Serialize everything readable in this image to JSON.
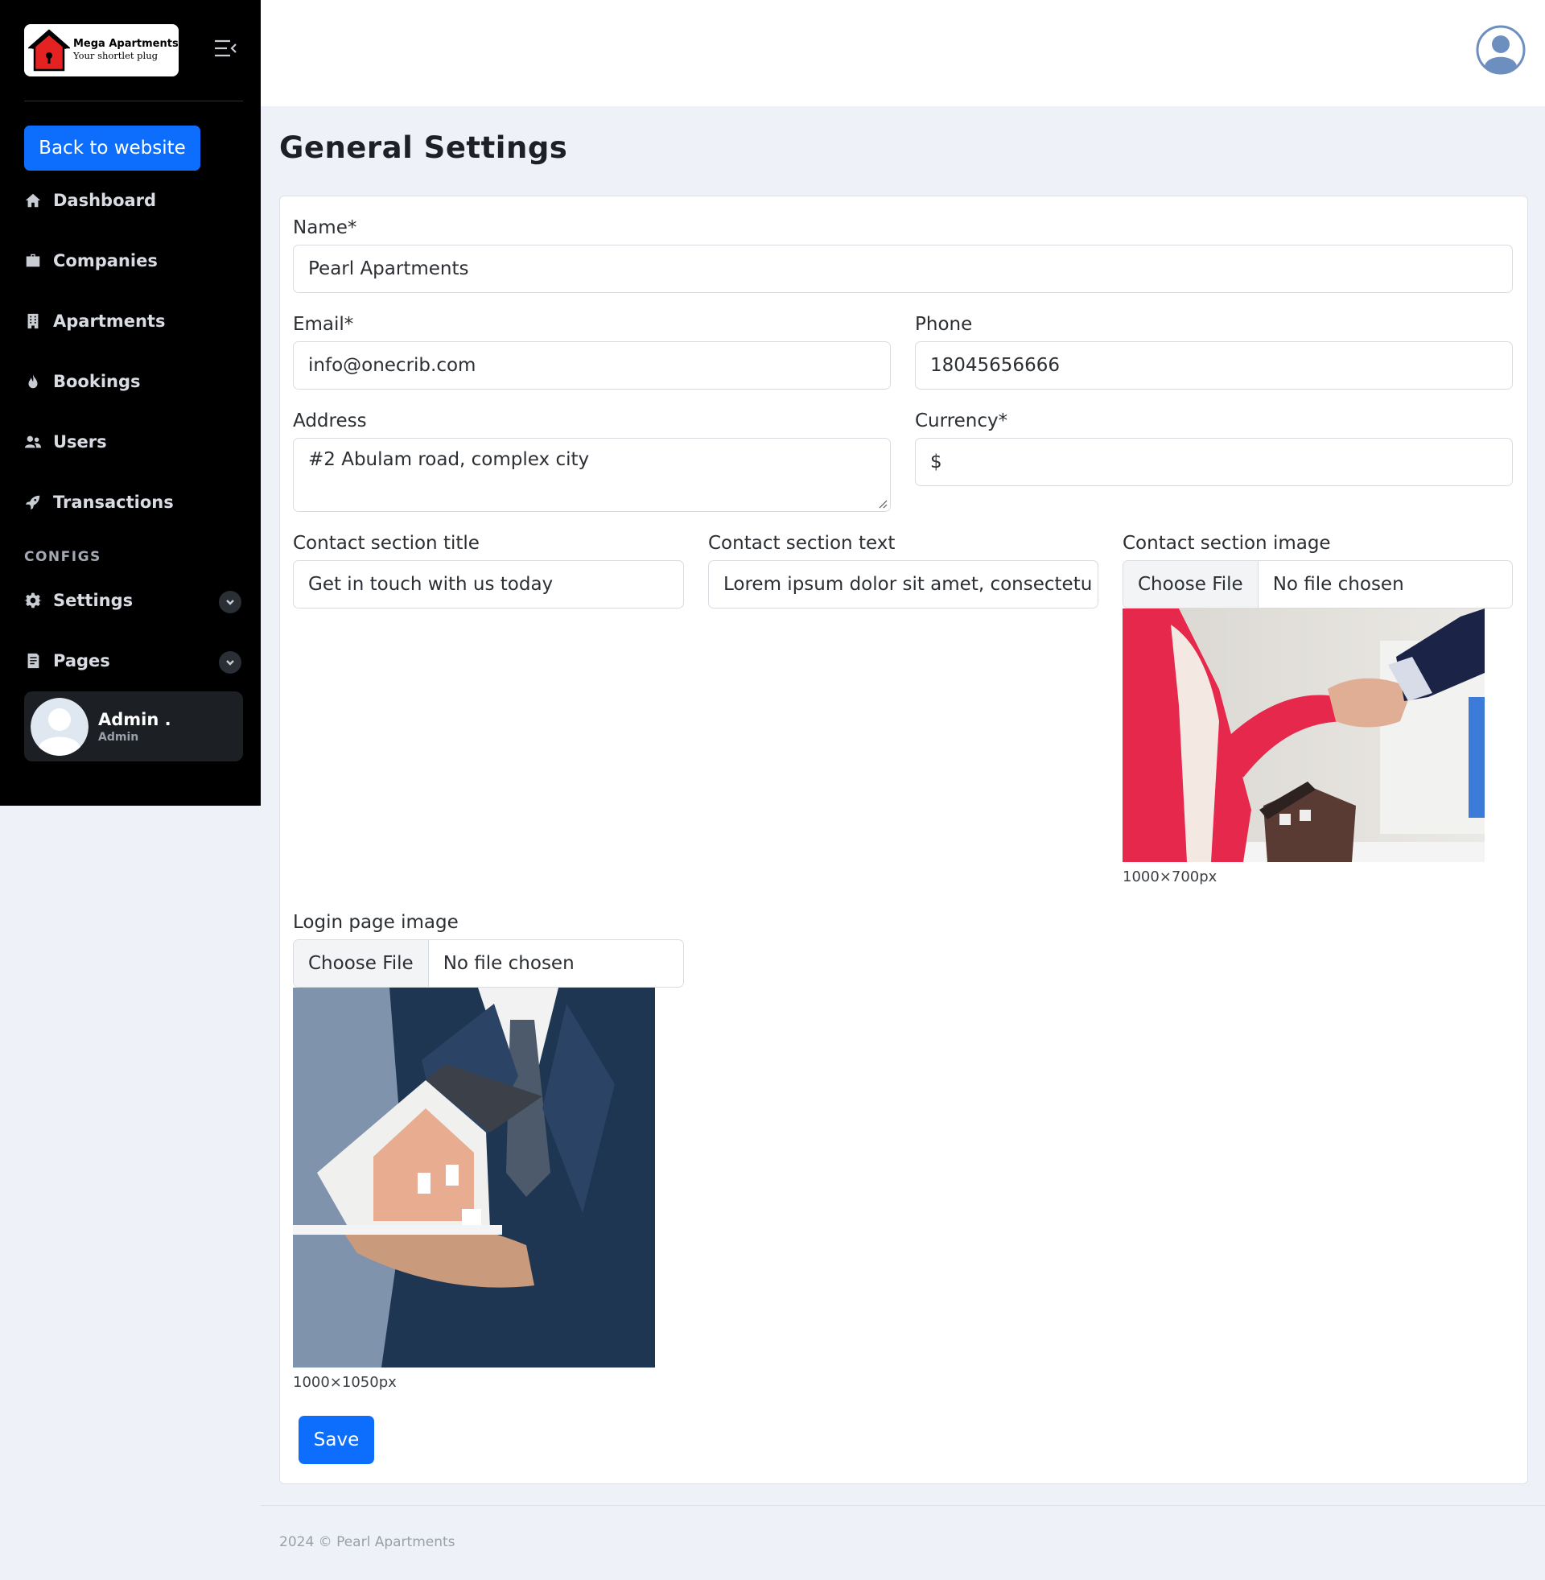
{
  "brand": {
    "title": "Mega Apartments",
    "subtitle": "Your shortlet plug"
  },
  "sidebar": {
    "back_label": "Back to website",
    "items": [
      {
        "label": "Dashboard",
        "icon": "home-icon"
      },
      {
        "label": "Companies",
        "icon": "briefcase-icon"
      },
      {
        "label": "Apartments",
        "icon": "building-icon"
      },
      {
        "label": "Bookings",
        "icon": "fire-icon"
      },
      {
        "label": "Users",
        "icon": "users-icon"
      },
      {
        "label": "Transactions",
        "icon": "rocket-icon"
      }
    ],
    "section_label": "CONFIGS",
    "config_items": [
      {
        "label": "Settings",
        "icon": "gear-icon"
      },
      {
        "label": "Pages",
        "icon": "document-icon"
      }
    ],
    "user": {
      "name": "Admin .",
      "role": "Admin"
    }
  },
  "page": {
    "title": "General Settings"
  },
  "form": {
    "name_label": "Name*",
    "name_value": "Pearl Apartments",
    "email_label": "Email*",
    "email_value": "info@onecrib.com",
    "phone_label": "Phone",
    "phone_value": "18045656666",
    "address_label": "Address",
    "address_value": "#2 Abulam road, complex city",
    "currency_label": "Currency*",
    "currency_value": "$",
    "contact_title_label": "Contact section title",
    "contact_title_value": "Get in touch with us today",
    "contact_text_label": "Contact section text",
    "contact_text_value": "Lorem ipsum dolor sit amet, consectetu",
    "contact_image_label": "Contact section image",
    "contact_image_hint": "1000×700px",
    "login_image_label": "Login page image",
    "login_image_hint": "1000×1050px",
    "choose_file_label": "Choose File",
    "no_file_label": "No file chosen",
    "save_label": "Save"
  },
  "footer": {
    "text": "2024 © Pearl Apartments"
  },
  "colors": {
    "primary": "#0d6efd",
    "sidebar": "#000000",
    "background": "#eef2f8"
  }
}
